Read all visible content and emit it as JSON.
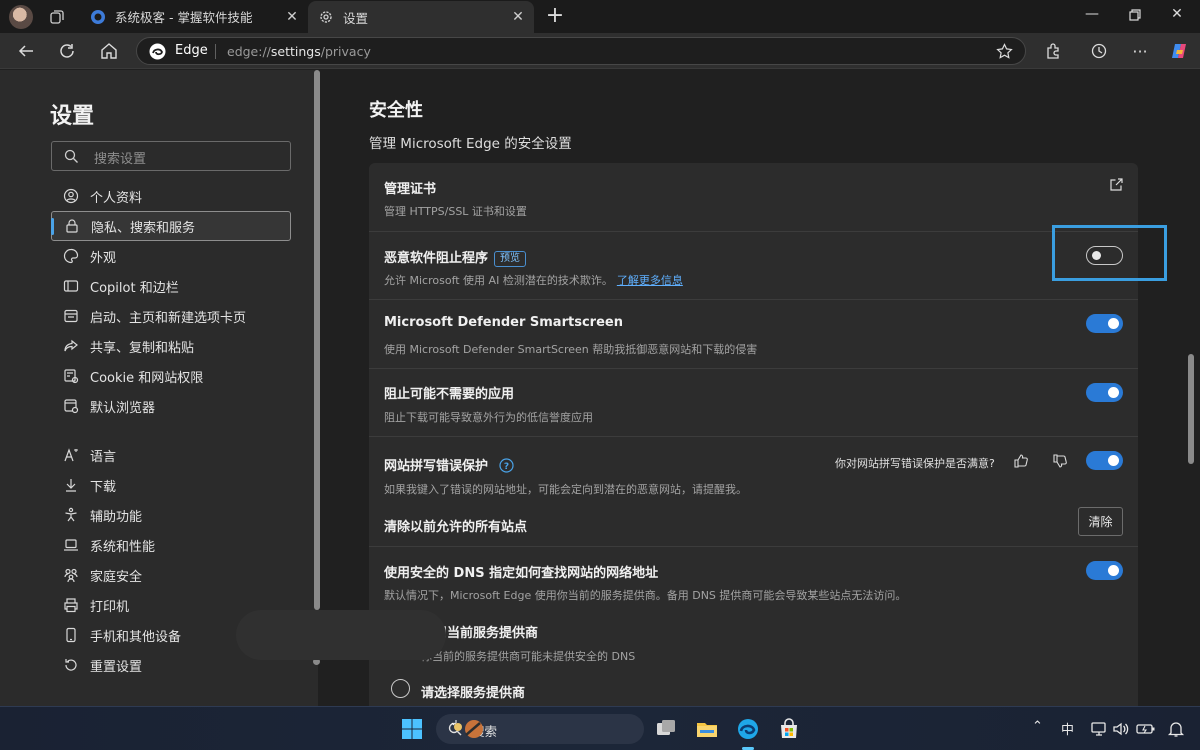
{
  "tabs": [
    {
      "title": "系统极客 - 掌握软件技能",
      "active": false
    },
    {
      "title": "设置",
      "active": true
    }
  ],
  "address": {
    "brand": "Edge",
    "url_prefix": "edge://",
    "url_host": "settings",
    "url_path": "/privacy"
  },
  "sidebar": {
    "title": "设置",
    "search_placeholder": "搜索设置",
    "items": [
      {
        "label": "个人资料",
        "icon": "profile-icon"
      },
      {
        "label": "隐私、搜索和服务",
        "icon": "lock-icon",
        "active": true
      },
      {
        "label": "外观",
        "icon": "palette-icon"
      },
      {
        "label": "Copilot 和边栏",
        "icon": "sidebar-icon"
      },
      {
        "label": "启动、主页和新建选项卡页",
        "icon": "power-icon"
      },
      {
        "label": "共享、复制和粘贴",
        "icon": "share-icon"
      },
      {
        "label": "Cookie 和网站权限",
        "icon": "cookie-icon"
      },
      {
        "label": "默认浏览器",
        "icon": "browser-icon"
      },
      {
        "label": "语言",
        "icon": "language-icon"
      },
      {
        "label": "下载",
        "icon": "download-icon"
      },
      {
        "label": "辅助功能",
        "icon": "accessibility-icon"
      },
      {
        "label": "系统和性能",
        "icon": "laptop-icon"
      },
      {
        "label": "家庭安全",
        "icon": "family-icon"
      },
      {
        "label": "打印机",
        "icon": "printer-icon"
      },
      {
        "label": "手机和其他设备",
        "icon": "phone-icon"
      },
      {
        "label": "重置设置",
        "icon": "reset-icon"
      }
    ]
  },
  "main": {
    "title": "安全性",
    "subtitle": "管理 Microsoft Edge 的安全设置",
    "rows": {
      "certs": {
        "label": "管理证书",
        "desc": "管理 HTTPS/SSL 证书和设置"
      },
      "malware": {
        "label": "恶意软件阻止程序",
        "badge": "预览",
        "desc": "允许 Microsoft 使用 AI 检测潜在的技术欺诈。",
        "link": "了解更多信息",
        "enabled": false
      },
      "smartscreen": {
        "label": "Microsoft Defender Smartscreen",
        "desc": "使用 Microsoft Defender SmartScreen 帮助我抵御恶意网站和下载的侵害",
        "enabled": true
      },
      "pua": {
        "label": "阻止可能不需要的应用",
        "desc": "阻止下载可能导致意外行为的低信誉度应用",
        "enabled": true
      },
      "typo": {
        "label": "网站拼写错误保护",
        "desc": "如果我键入了错误的网站地址，可能会定向到潜在的恶意网站，请提醒我。",
        "feedback": "你对网站拼写错误保护是否满意?",
        "enabled": true
      },
      "clear": {
        "label": "清除以前允许的所有站点",
        "button": "清除"
      },
      "dns": {
        "label": "使用安全的 DNS 指定如何查找网站的网络地址",
        "desc": "默认情况下，Microsoft Edge 使用你当前的服务提供商。备用 DNS 提供商可能会导致某些站点无法访问。",
        "enabled": true
      },
      "dns_current": {
        "label": "使用当前服务提供商",
        "desc": "你当前的服务提供商可能未提供安全的 DNS"
      },
      "dns_choose": {
        "label": "请选择服务提供商"
      }
    }
  },
  "taskbar": {
    "search_label": "搜索",
    "ime": "中"
  },
  "colors": {
    "accent": "#2a7ad6",
    "highlight": "#3a9ee0",
    "link": "#5fb0ff"
  }
}
